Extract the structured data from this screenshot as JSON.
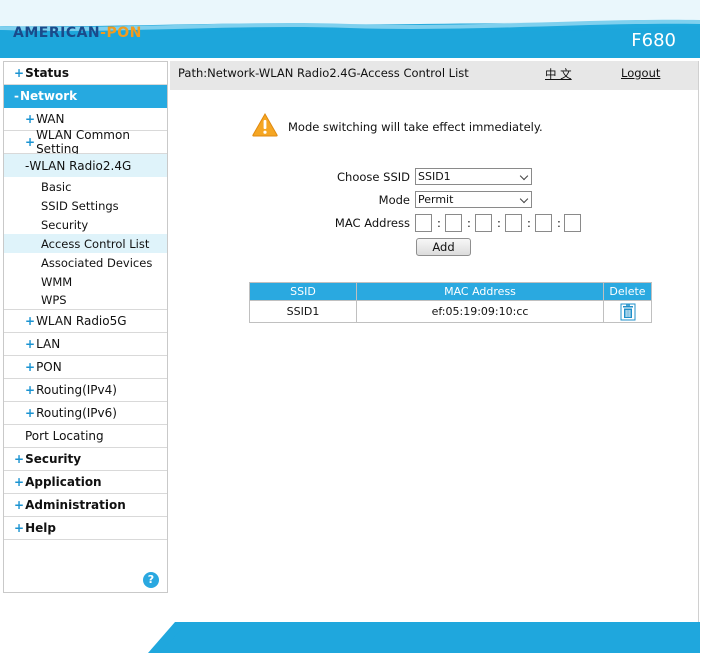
{
  "header": {
    "logo": {
      "american": "AMERICAN",
      "dash": "-",
      "pon": "PON"
    },
    "model": "F680"
  },
  "sidebar": {
    "items": [
      {
        "label": "Status",
        "prefix": "+",
        "level": 1
      },
      {
        "label": "Network",
        "prefix": "-",
        "level": 1
      },
      {
        "label": "WAN",
        "prefix": "+",
        "level": 2
      },
      {
        "label": "WLAN Common Setting",
        "prefix": "+",
        "level": 2
      },
      {
        "label": "WLAN Radio2.4G",
        "prefix": "-",
        "level": 2
      },
      {
        "label": "Basic",
        "level": 3
      },
      {
        "label": "SSID Settings",
        "level": 3
      },
      {
        "label": "Security",
        "level": 3
      },
      {
        "label": "Access Control List",
        "level": 3
      },
      {
        "label": "Associated Devices",
        "level": 3
      },
      {
        "label": "WMM",
        "level": 3
      },
      {
        "label": "WPS",
        "level": 3
      },
      {
        "label": "WLAN Radio5G",
        "prefix": "+",
        "level": 2
      },
      {
        "label": "LAN",
        "prefix": "+",
        "level": 2
      },
      {
        "label": "PON",
        "prefix": "+",
        "level": 2
      },
      {
        "label": "Routing(IPv4)",
        "prefix": "+",
        "level": 2
      },
      {
        "label": "Routing(IPv6)",
        "prefix": "+",
        "level": 2
      },
      {
        "label": "Port Locating",
        "level": 2
      },
      {
        "label": "Security",
        "prefix": "+",
        "level": 1
      },
      {
        "label": "Application",
        "prefix": "+",
        "level": 1
      },
      {
        "label": "Administration",
        "prefix": "+",
        "level": 1
      },
      {
        "label": "Help",
        "prefix": "+",
        "level": 1
      }
    ],
    "help_icon": "?"
  },
  "pathbar": {
    "path": "Path:Network-WLAN Radio2.4G-Access Control List",
    "language": "中 文",
    "logout": "Logout"
  },
  "notice": {
    "icon": "warning-icon",
    "text": "Mode switching will take effect immediately."
  },
  "form": {
    "ssid_label": "Choose SSID",
    "ssid_value": "SSID1",
    "mode_label": "Mode",
    "mode_value": "Permit",
    "mac_label": "MAC Address",
    "mac_separator": ":",
    "mac_fields": [
      "",
      "",
      "",
      "",
      "",
      ""
    ],
    "add_button": "Add"
  },
  "table": {
    "headers": [
      "SSID",
      "MAC Address",
      "Delete"
    ],
    "rows": [
      {
        "ssid": "SSID1",
        "mac": "ef:05:19:09:10:cc",
        "delete_icon": "trash-icon"
      }
    ]
  },
  "colors": {
    "accent": "#26a9e0",
    "logo_blue": "#1a4a8a",
    "logo_orange": "#f29b1d",
    "warning": "#f5a623"
  }
}
